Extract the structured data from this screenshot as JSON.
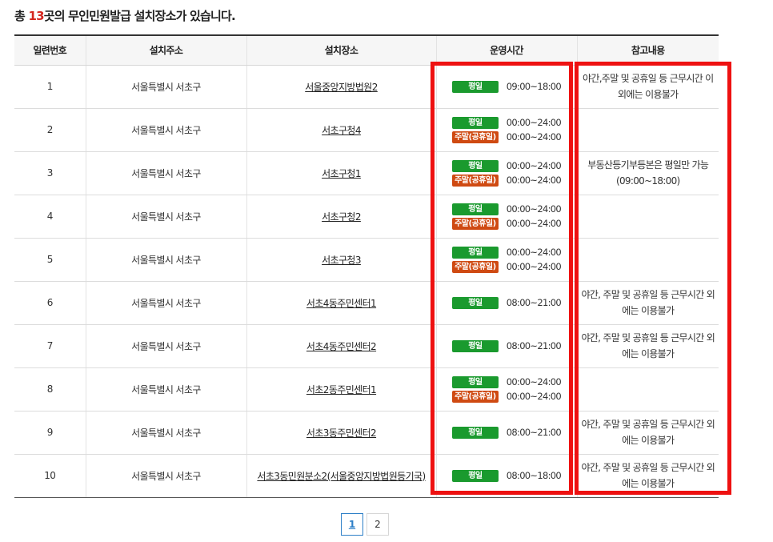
{
  "summary": {
    "prefix": "총 ",
    "count": "13",
    "suffix": "곳의 무인민원발급 설치장소가 있습니다."
  },
  "table": {
    "headers": [
      "일련번호",
      "설치주소",
      "설치장소",
      "운영시간",
      "참고내용"
    ],
    "rows": [
      {
        "no": "1",
        "address": "서울특별시 서초구",
        "place": "서울중앙지방법원2",
        "hours": [
          {
            "type": "weekday",
            "label": "평일",
            "time": "09:00~18:00"
          }
        ],
        "note": "야간,주말 및 공휴일 등 근무시간 이외에는 이용불가"
      },
      {
        "no": "2",
        "address": "서울특별시 서초구",
        "place": "서초구청4",
        "hours": [
          {
            "type": "weekday",
            "label": "평일",
            "time": "00:00~24:00"
          },
          {
            "type": "weekend",
            "label": "주말(공휴일)",
            "time": "00:00~24:00"
          }
        ],
        "note": ""
      },
      {
        "no": "3",
        "address": "서울특별시 서초구",
        "place": "서초구청1",
        "hours": [
          {
            "type": "weekday",
            "label": "평일",
            "time": "00:00~24:00"
          },
          {
            "type": "weekend",
            "label": "주말(공휴일)",
            "time": "00:00~24:00"
          }
        ],
        "note": "부동산등기부등본은 평일만 가능(09:00~18:00)"
      },
      {
        "no": "4",
        "address": "서울특별시 서초구",
        "place": "서초구청2",
        "hours": [
          {
            "type": "weekday",
            "label": "평일",
            "time": "00:00~24:00"
          },
          {
            "type": "weekend",
            "label": "주말(공휴일)",
            "time": "00:00~24:00"
          }
        ],
        "note": ""
      },
      {
        "no": "5",
        "address": "서울특별시 서초구",
        "place": "서초구청3",
        "hours": [
          {
            "type": "weekday",
            "label": "평일",
            "time": "00:00~24:00"
          },
          {
            "type": "weekend",
            "label": "주말(공휴일)",
            "time": "00:00~24:00"
          }
        ],
        "note": ""
      },
      {
        "no": "6",
        "address": "서울특별시 서초구",
        "place": "서초4동주민센터1",
        "hours": [
          {
            "type": "weekday",
            "label": "평일",
            "time": "08:00~21:00"
          }
        ],
        "note": "야간, 주말 및 공휴일 등 근무시간 외에는 이용불가"
      },
      {
        "no": "7",
        "address": "서울특별시 서초구",
        "place": "서초4동주민센터2",
        "hours": [
          {
            "type": "weekday",
            "label": "평일",
            "time": "08:00~21:00"
          }
        ],
        "note": "야간, 주말 및 공휴일 등 근무시간 외에는 이용불가"
      },
      {
        "no": "8",
        "address": "서울특별시 서초구",
        "place": "서초2동주민센터1",
        "hours": [
          {
            "type": "weekday",
            "label": "평일",
            "time": "00:00~24:00"
          },
          {
            "type": "weekend",
            "label": "주말(공휴일)",
            "time": "00:00~24:00"
          }
        ],
        "note": ""
      },
      {
        "no": "9",
        "address": "서울특별시 서초구",
        "place": "서초3동주민센터2",
        "hours": [
          {
            "type": "weekday",
            "label": "평일",
            "time": "08:00~21:00"
          }
        ],
        "note": "야간, 주말 및 공휴일 등 근무시간 외에는 이용불가"
      },
      {
        "no": "10",
        "address": "서울특별시 서초구",
        "place": "서초3동민원분소2(서울중앙지방법원등기국)",
        "hours": [
          {
            "type": "weekday",
            "label": "평일",
            "time": "08:00~18:00"
          }
        ],
        "note": "야간, 주말 및 공휴일 등 근무시간 외에는 이용불가"
      }
    ]
  },
  "pagination": {
    "pages": [
      "1",
      "2"
    ],
    "current": "1"
  },
  "colors": {
    "highlight_box": "#ee1111",
    "weekday_badge": "#1a9a2e",
    "weekend_badge": "#cf4a12",
    "count_accent": "#d4261f",
    "active_page": "#2d7fc7"
  }
}
